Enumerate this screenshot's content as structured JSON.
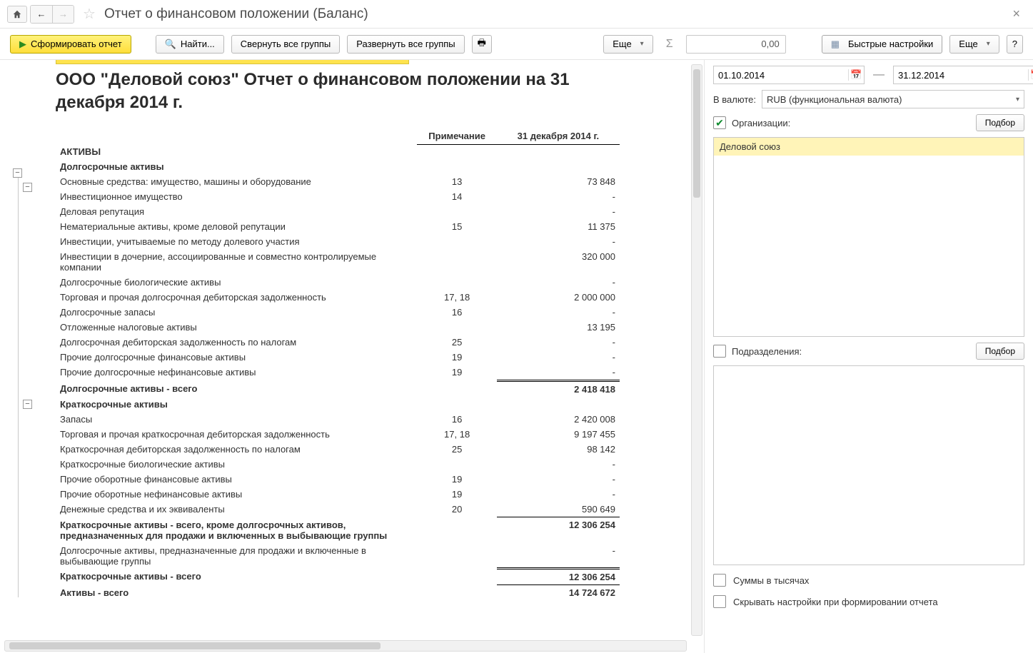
{
  "title": "Отчет о финансовом положении (Баланс)",
  "toolbar": {
    "run": "Сформировать отчет",
    "find": "Найти...",
    "collapse": "Свернуть все группы",
    "expand": "Развернуть все группы",
    "more1": "Еще",
    "sum_value": "0,00",
    "quick": "Быстрые настройки",
    "more2": "Еще",
    "help": "?"
  },
  "report": {
    "heading": "ООО \"Деловой союз\" Отчет о финансовом положении на 31 декабря 2014 г.",
    "col_note": "Примечание",
    "col_date": "31 декабря 2014 г.",
    "sections": [
      {
        "type": "section",
        "name": "АКТИВЫ"
      },
      {
        "type": "section",
        "name": "Долгосрочные активы"
      },
      {
        "type": "row",
        "name": "Основные средства: имущество, машины и оборудование",
        "note": "13",
        "value": "73 848"
      },
      {
        "type": "row",
        "name": "Инвестиционное имущество",
        "note": "14",
        "value": "-"
      },
      {
        "type": "row",
        "name": "Деловая репутация",
        "note": "",
        "value": "-"
      },
      {
        "type": "row",
        "name": "Нематериальные активы, кроме деловой репутации",
        "note": "15",
        "value": "11 375"
      },
      {
        "type": "row",
        "name": "Инвестиции, учитываемые по методу долевого участия",
        "note": "",
        "value": "-"
      },
      {
        "type": "row",
        "name": "Инвестиции в дочерние, ассоциированные и совместно контролируемые компании",
        "note": "",
        "value": "320 000"
      },
      {
        "type": "row",
        "name": "Долгосрочные биологические активы",
        "note": "",
        "value": "-"
      },
      {
        "type": "row",
        "name": "Торговая и прочая долгосрочная дебиторская задолженность",
        "note": "17, 18",
        "value": "2 000 000"
      },
      {
        "type": "row",
        "name": "Долгосрочные запасы",
        "note": "16",
        "value": "-"
      },
      {
        "type": "row",
        "name": "Отложенные налоговые активы",
        "note": "",
        "value": "13 195"
      },
      {
        "type": "row",
        "name": "Долгосрочная дебиторская задолженность по налогам",
        "note": "25",
        "value": "-"
      },
      {
        "type": "row",
        "name": "Прочие долгосрочные финансовые активы",
        "note": "19",
        "value": "-"
      },
      {
        "type": "row",
        "name": "Прочие долгосрочные нефинансовые активы",
        "note": "19",
        "value": "-"
      },
      {
        "type": "total-dbl",
        "name": "Долгосрочные активы - всего",
        "note": "",
        "value": "2 418 418"
      },
      {
        "type": "section",
        "name": "Краткосрочные активы"
      },
      {
        "type": "row",
        "name": "Запасы",
        "note": "16",
        "value": "2 420 008"
      },
      {
        "type": "row",
        "name": "Торговая и прочая краткосрочная дебиторская задолженность",
        "note": "17, 18",
        "value": "9 197 455"
      },
      {
        "type": "row",
        "name": "Краткосрочная дебиторская задолженность по налогам",
        "note": "25",
        "value": "98 142"
      },
      {
        "type": "row",
        "name": "Краткосрочные биологические активы",
        "note": "",
        "value": "-"
      },
      {
        "type": "row",
        "name": "Прочие оборотные финансовые активы",
        "note": "19",
        "value": "-"
      },
      {
        "type": "row",
        "name": "Прочие оборотные нефинансовые активы",
        "note": "19",
        "value": "-"
      },
      {
        "type": "row",
        "name": "Денежные средства и их эквиваленты",
        "note": "20",
        "value": "590 649"
      },
      {
        "type": "total",
        "name": "Краткосрочные активы - всего, кроме долгосрочных активов, предназначенных для продажи и включенных в выбывающие группы",
        "note": "",
        "value": "12 306 254"
      },
      {
        "type": "row",
        "name": "Долгосрочные активы, предназначенные для продажи и включенные в выбывающие группы",
        "note": "",
        "value": "-"
      },
      {
        "type": "total-dbl",
        "name": "Краткосрочные активы - всего",
        "note": "",
        "value": "12 306 254"
      },
      {
        "type": "total",
        "name": "Активы - всего",
        "note": "",
        "value": "14 724 672"
      }
    ]
  },
  "settings": {
    "date_from": "01.10.2014",
    "date_to": "31.12.2014",
    "currency_label": "В валюте:",
    "currency_value": "RUB (функциональная валюта)",
    "orgs_label": "Организации:",
    "orgs_pick": "Подбор",
    "orgs_items": [
      "Деловой союз"
    ],
    "divs_label": "Подразделения:",
    "divs_pick": "Подбор",
    "thousands": "Суммы в тысячах",
    "hide_settings": "Скрывать настройки при формировании отчета"
  }
}
